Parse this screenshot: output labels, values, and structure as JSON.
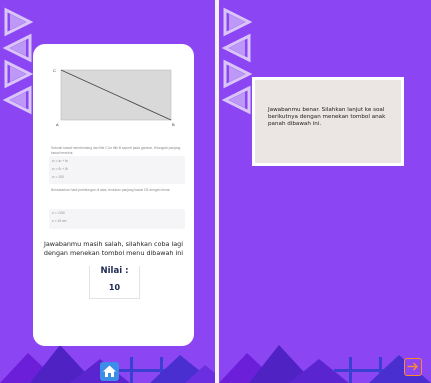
{
  "theme": {
    "background": "#8b45f2",
    "card": "#ffffff",
    "accent_home": "#3d8de8",
    "accent_next": "#ff8a2b",
    "feedback_bg": "#ebe5e3"
  },
  "left": {
    "figure": {
      "label_c": "C",
      "label_a": "A",
      "label_b": "B"
    },
    "question": {
      "intro": "Sebuah kawat membentang dari titik C ke titik B seperti pada gambar. Hitunglah panjang kawat tersebut.",
      "lines_1": [
        "c² = a² + b²",
        "c² = 6² + 8²",
        "c² = 100"
      ],
      "middle": "Berdasarkan hasil perhitungan di atas, tentukan panjang kawat CB dengan benar.",
      "lines_2": [
        "c = √100",
        "c = 10 cm"
      ]
    },
    "message": "Jawabanmu masih salah, silahkan coba lagi dengan menekan tombol menu dibawah ini",
    "score": {
      "title": "Nilai :",
      "value": "10"
    },
    "home_icon": "home-icon"
  },
  "right": {
    "feedback": "Jawabanmu benar. Silahkan lanjut ke soal berikutnya dengan menekan tombol anak panah  dibawah ini.",
    "next_icon": "arrow-right-icon"
  }
}
